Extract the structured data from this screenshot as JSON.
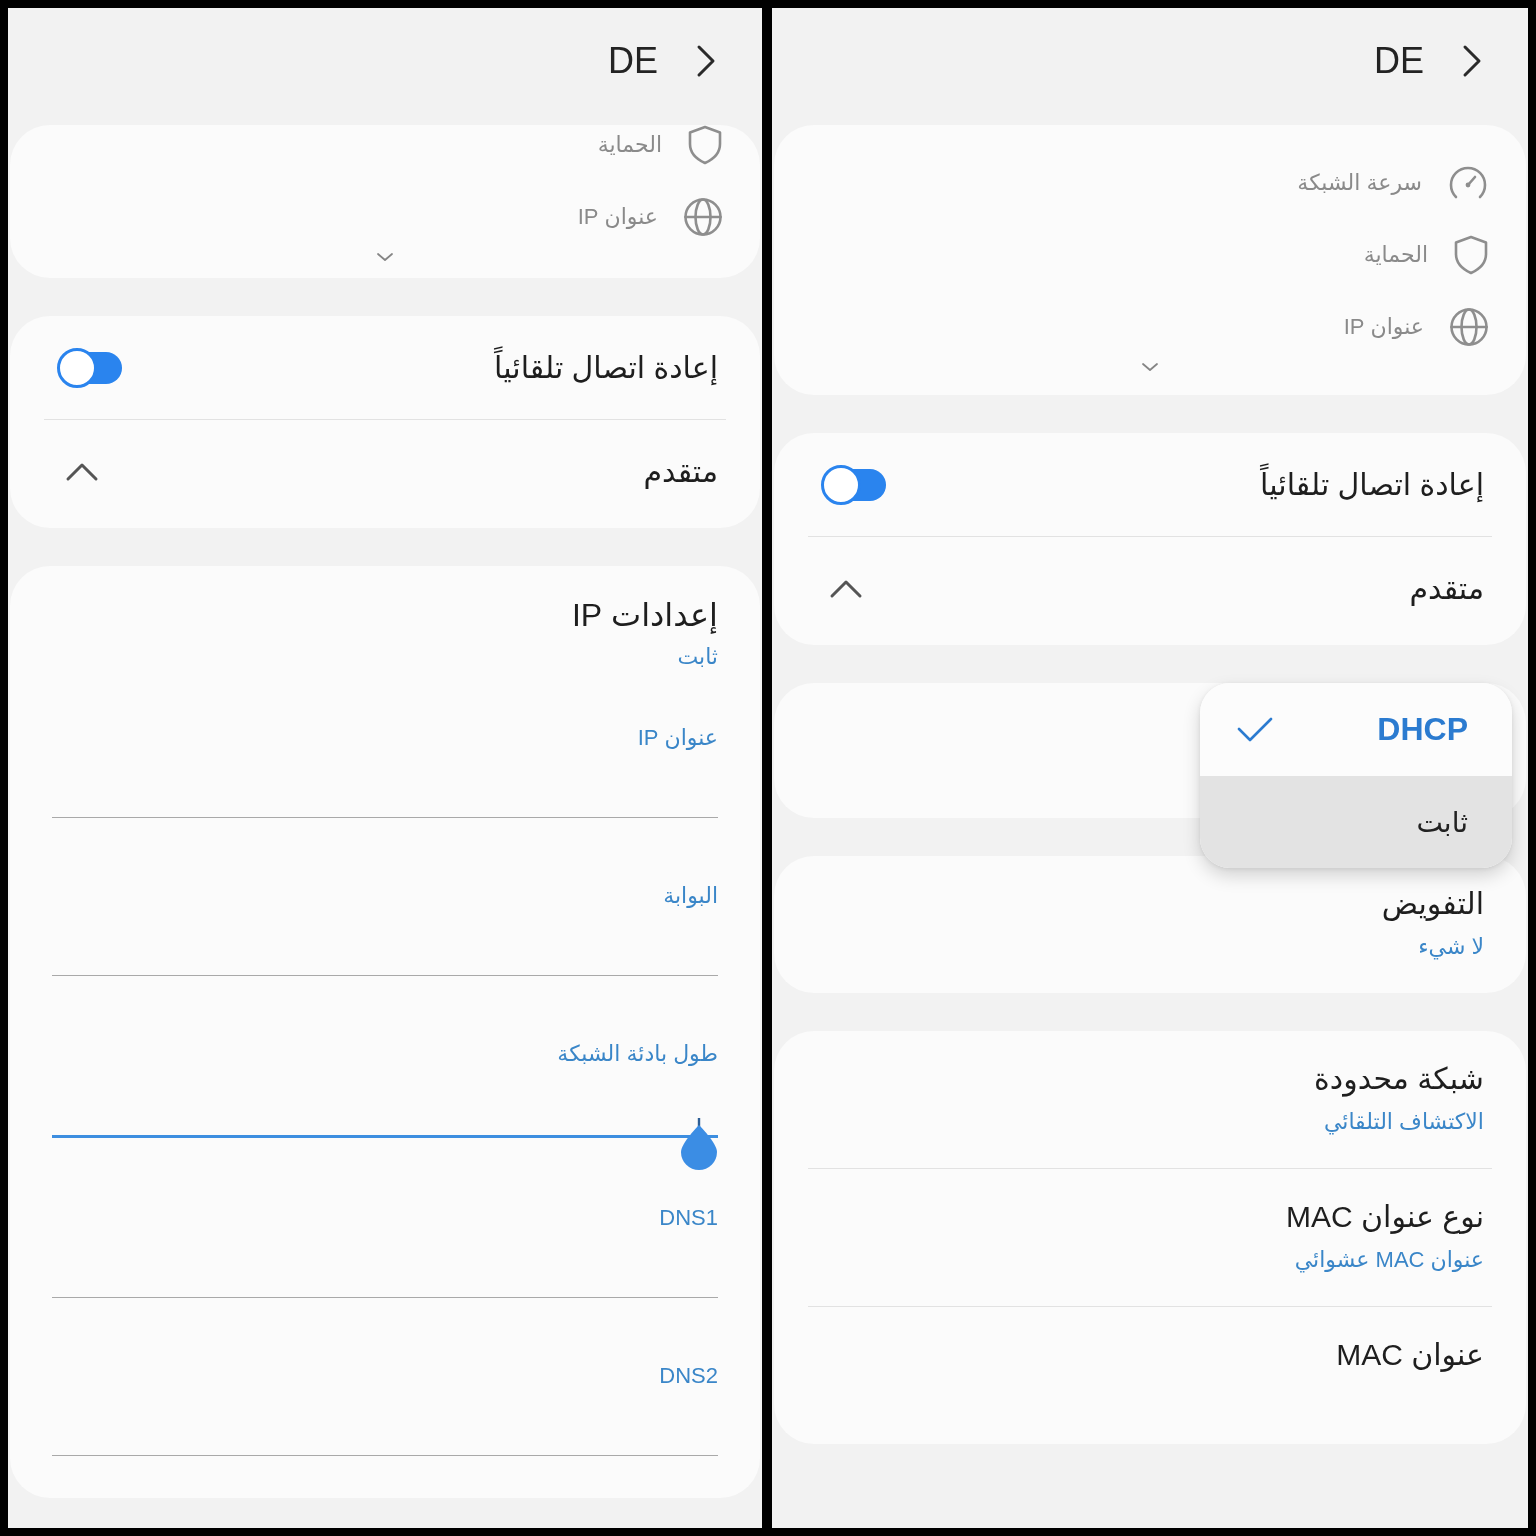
{
  "panels": [
    {
      "header": {
        "title": "DE"
      },
      "scrolled": false,
      "cards": [
        {
          "kind": "info",
          "expanded": false,
          "rows": [
            {
              "kind": "speed",
              "label": "سرعة الشبكة"
            },
            {
              "kind": "security",
              "label": "الحماية"
            },
            {
              "kind": "ip_address",
              "label": "عنوان IP"
            }
          ]
        },
        {
          "kind": "list",
          "rows": [
            {
              "kind": "switch",
              "label": "إعادة اتصال تلقائياً",
              "on": true
            },
            {
              "kind": "expander",
              "label": "متقدم",
              "expanded": true
            }
          ]
        },
        {
          "kind": "menu",
          "options": [
            {
              "label": "DHCP",
              "selected": true,
              "pressed": false
            },
            {
              "label": "ثابت",
              "selected": false,
              "pressed": true
            }
          ]
        },
        {
          "kind": "list",
          "rows": [
            {
              "kind": "detail",
              "label": "التفويض",
              "value": "لا شيء"
            }
          ]
        },
        {
          "kind": "list",
          "rows": [
            {
              "kind": "detail",
              "label": "شبكة محدودة",
              "value": "الاكتشاف التلقائي"
            },
            {
              "kind": "detail",
              "label": "نوع عنوان MAC",
              "value": "عنوان MAC عشوائي"
            },
            {
              "kind": "detail",
              "label": "عنوان MAC"
            }
          ]
        }
      ]
    },
    {
      "header": {
        "title": "DE"
      },
      "scrolled": true,
      "cards": [
        {
          "kind": "info",
          "expanded": false,
          "rows": [
            {
              "kind": "security",
              "label": "الحماية"
            },
            {
              "kind": "ip_address",
              "label": "عنوان IP"
            }
          ]
        },
        {
          "kind": "list",
          "rows": [
            {
              "kind": "switch",
              "label": "إعادة اتصال تلقائياً",
              "on": true
            },
            {
              "kind": "expander",
              "label": "متقدم",
              "expanded": true
            }
          ]
        },
        {
          "kind": "form",
          "title": "إعدادات IP",
          "value": "ثابت",
          "fields": [
            {
              "kind": "text",
              "label": "عنوان IP"
            },
            {
              "kind": "text",
              "label": "البوابة"
            },
            {
              "kind": "slider",
              "label": "طول بادئة الشبكة",
              "level": 1
            },
            {
              "kind": "text",
              "label": "DNS1"
            },
            {
              "kind": "text",
              "label": "DNS2"
            }
          ]
        }
      ]
    }
  ]
}
